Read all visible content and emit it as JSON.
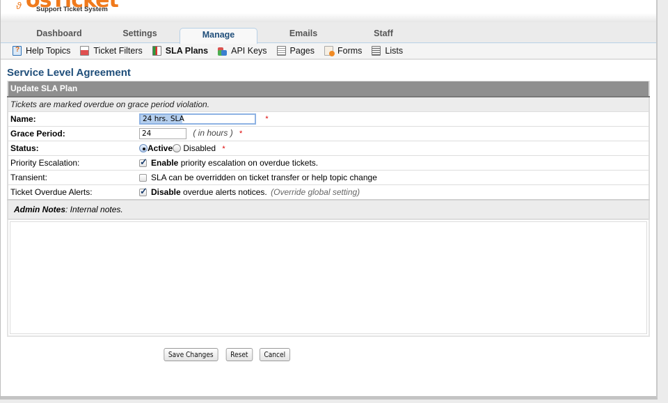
{
  "header": {
    "logo_text": "osTicket",
    "logo_subtitle": "Support Ticket System",
    "brand_color": "#f07a1c"
  },
  "nav": {
    "tabs": [
      {
        "label": "Dashboard",
        "active": false
      },
      {
        "label": "Settings",
        "active": false
      },
      {
        "label": "Manage",
        "active": true
      },
      {
        "label": "Emails",
        "active": false
      },
      {
        "label": "Staff",
        "active": false
      }
    ]
  },
  "subnav": {
    "items": [
      {
        "label": "Help Topics",
        "icon": "help-topics-icon",
        "active": false
      },
      {
        "label": "Ticket Filters",
        "icon": "ticket-filters-icon",
        "active": false
      },
      {
        "label": "SLA Plans",
        "icon": "sla-plans-icon",
        "active": true
      },
      {
        "label": "API Keys",
        "icon": "api-keys-icon",
        "active": false
      },
      {
        "label": "Pages",
        "icon": "pages-icon",
        "active": false
      },
      {
        "label": "Forms",
        "icon": "forms-icon",
        "active": false
      },
      {
        "label": "Lists",
        "icon": "lists-icon",
        "active": false
      }
    ]
  },
  "page": {
    "title": "Service Level Agreement",
    "title_color": "#1f4e7a"
  },
  "form": {
    "header": "Update SLA Plan",
    "subheader": "Tickets are marked overdue on grace period violation.",
    "required_marker": "*",
    "name": {
      "label": "Name:",
      "value": "24 hrs. SLA"
    },
    "grace_period": {
      "label": "Grace Period:",
      "value": "24",
      "hint": "( in hours )"
    },
    "status": {
      "label": "Status:",
      "options": [
        {
          "label": "Active",
          "selected": true
        },
        {
          "label": "Disabled",
          "selected": false
        }
      ]
    },
    "priority_escalation": {
      "label": "Priority Escalation:",
      "checked": true,
      "strong": "Enable",
      "text": "priority escalation on overdue tickets."
    },
    "transient": {
      "label": "Transient:",
      "checked": false,
      "text": "SLA can be overridden on ticket transfer or help topic change"
    },
    "overdue_alerts": {
      "label": "Ticket Overdue Alerts:",
      "checked": true,
      "strong": "Disable",
      "text": "overdue alerts notices.",
      "hint": "(Override global setting)"
    },
    "admin_notes": {
      "label": "Admin Notes",
      "hint": ": Internal notes.",
      "value": ""
    }
  },
  "buttons": {
    "save": "Save Changes",
    "reset": "Reset",
    "cancel": "Cancel"
  }
}
